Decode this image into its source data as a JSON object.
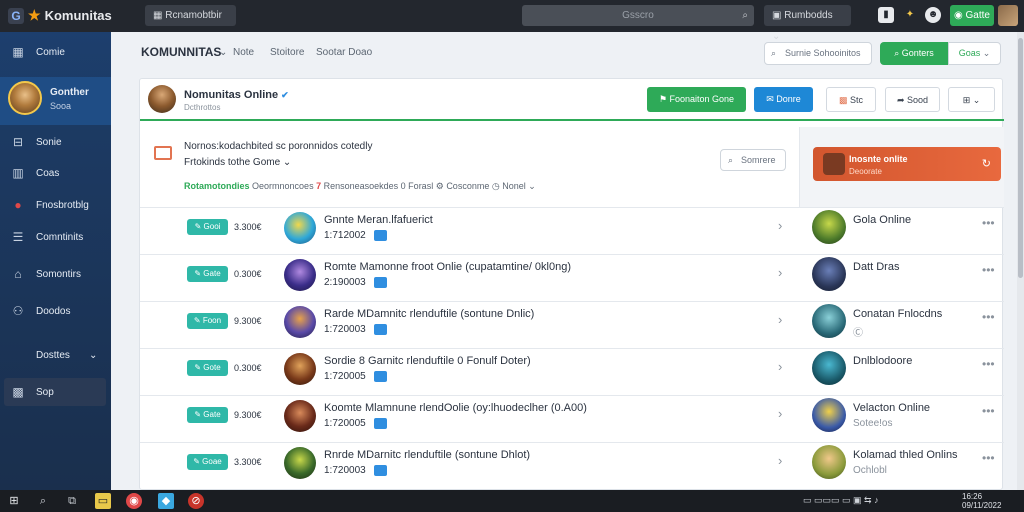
{
  "topbar": {
    "brand": "Komunitas",
    "btn1": "Rcnamobtbir",
    "search_placeholder": "Gsscro",
    "btn2": "Rumbodds",
    "green_btn": "Gatte"
  },
  "sidebar": {
    "items": [
      {
        "label": "Comie",
        "icon": "grid-icon"
      },
      {
        "label": "Sonie",
        "icon": "folder-icon"
      },
      {
        "label": "Coas",
        "icon": "building-icon"
      },
      {
        "label": "Fnosbrotblg",
        "icon": "record-icon"
      },
      {
        "label": "Comntinits",
        "icon": "list-icon"
      },
      {
        "label": "Somontirs",
        "icon": "home-icon"
      },
      {
        "label": "Doodos",
        "icon": "people-icon"
      },
      {
        "label": "Dosttes",
        "icon": "chevron-down-icon"
      },
      {
        "label": "Sop",
        "icon": "gift-icon"
      }
    ],
    "profile": {
      "name": "Gonther",
      "sub": "Sooa"
    }
  },
  "header": {
    "title": "KOMUNNITAS",
    "nav": [
      "Note",
      "Stoitore",
      "Sootar Doao"
    ],
    "search": "Surnie Sohooinitos",
    "btn_green": "Gonters",
    "btn_green2": "Goas"
  },
  "profile_head": {
    "name": "Nomunitas Online",
    "sub": "Dcthrottos",
    "btn_green": "Foonaiton Gone",
    "btn_blue": "Donre",
    "btn_w1": "Stc",
    "btn_w2": "Sood",
    "btn_w3": ""
  },
  "notice": {
    "line1": "Nornos:kodachbited sc poronnidos cotedly",
    "line2": "Frtokinds tothe Gome",
    "line3_green": "Rotamotondies",
    "line3_a": "Oeormnoncoes",
    "line3_red": "7",
    "line3_b": "Rensoneasoekdes 0 Forasl",
    "line3_c": "Cosconme",
    "line3_d": "Nonel",
    "search_btn": "Somrere"
  },
  "orange_card": {
    "title": "Inosnte onlite",
    "sub": "Deoorate"
  },
  "rows": [
    {
      "tag": "Gooi",
      "amount": "3.300€",
      "title": "Gnnte Meran.lfafuerict",
      "meta": "1:712002",
      "right_name": "Gola Online",
      "right_sub": ""
    },
    {
      "tag": "Gate",
      "amount": "0.300€",
      "title": "Romte Mamonne froot Onlie (cupatamtine/ 0kl0ng)",
      "meta": "2:190003",
      "right_name": "Datt Dras",
      "right_sub": ""
    },
    {
      "tag": "Foon",
      "amount": "9.300€",
      "title": "Rarde MDamnitc rlenduftile (sontune Dnlic)",
      "meta": "1:720003",
      "right_name": "Conatan Fnlocdns",
      "right_sub": "Ⓒ"
    },
    {
      "tag": "Gote",
      "amount": "0.300€",
      "title": "Sordie 8 Garnitc rlenduftile 0 Fonulf Doter)",
      "meta": "1:720005",
      "right_name": "Dnlblodoore",
      "right_sub": ""
    },
    {
      "tag": "Gate",
      "amount": "9.300€",
      "title": "Koomte Mlamnune rlendOolie (oy:lhuodeclher (0.A00)",
      "meta": "1:720005",
      "right_name": "Velacton Online",
      "right_sub": "Sotee!os"
    },
    {
      "tag": "Goae",
      "amount": "3.300€",
      "title": "Rnrde MDarnitc rlenduftile (sontune Dhlot)",
      "meta": "1:720003",
      "right_name": "Kolamad thled Onlins",
      "right_sub": "Ochlobl"
    }
  ],
  "taskbar": {
    "time": "16:26",
    "date": "09/11/2022"
  }
}
